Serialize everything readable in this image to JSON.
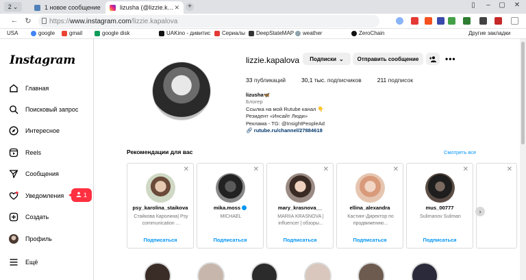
{
  "browser": {
    "tab_counter": "2",
    "tabs": [
      {
        "label": "1 новое сообщение",
        "active": false
      },
      {
        "label": "lizusha (@lizzie.kapalova...",
        "active": true
      }
    ],
    "url_protocol": "https://",
    "url_host": "www.instagram.com",
    "url_path": "/lizzie.kapalova",
    "bookmarks": [
      "USA",
      "google",
      "gmail",
      "google disk",
      "UAKino - дивитис",
      "Сериалы",
      "DeepStateMAP",
      "weather",
      "ZeroChain",
      "Другие закладки"
    ]
  },
  "instagram": {
    "logo": "Instagram",
    "nav": [
      {
        "label": "Главная",
        "icon": "home-icon"
      },
      {
        "label": "Поисковый запрос",
        "icon": "search-icon"
      },
      {
        "label": "Интересное",
        "icon": "compass-icon"
      },
      {
        "label": "Reels",
        "icon": "reels-icon"
      },
      {
        "label": "Сообщения",
        "icon": "messenger-icon"
      },
      {
        "label": "Уведомления",
        "icon": "heart-icon"
      },
      {
        "label": "Создать",
        "icon": "create-icon"
      },
      {
        "label": "Профиль",
        "icon": "profile-icon"
      },
      {
        "label": "Ещё",
        "icon": "menu-icon"
      }
    ],
    "notification_count": "1",
    "profile": {
      "username": "lizzie.kapalova",
      "follow_button": "Подписки",
      "message_button": "Отправить сообщение",
      "posts_count": "33",
      "posts_label": "публикаций",
      "followers_count": "30,1 тыс.",
      "followers_label": "подписчиков",
      "following_count": "211",
      "following_label": "подписок",
      "display_name": "lizusha🦋",
      "category": "Блогер",
      "bio_lines": [
        "Ссылка на мой Rutube канал 👇",
        "Резидент «Инсайт Люди»",
        "Реклама - TG: @InsightPeopleAd"
      ],
      "link": "rutube.ru/channel/27884618"
    },
    "recommendations": {
      "title": "Рекомендации для вас",
      "see_all": "Смотреть все",
      "follow_label": "Подписаться",
      "items": [
        {
          "username": "psy_karolina_staikova",
          "subtitle": "Стайкова Каролина| Psy communication ...",
          "verified": false
        },
        {
          "username": "mika.moss",
          "subtitle": "MICHAEL",
          "verified": true
        },
        {
          "username": "mary_krasnova__",
          "subtitle": "MARIIA KRASNOVA | influencer | обзоры...",
          "verified": false
        },
        {
          "username": "ellina_alexandra",
          "subtitle": "Кастинг-Директор по продвижению...",
          "verified": false
        },
        {
          "username": "mus_00777",
          "subtitle": "Sulimanov Suliman",
          "verified": false
        }
      ]
    }
  }
}
